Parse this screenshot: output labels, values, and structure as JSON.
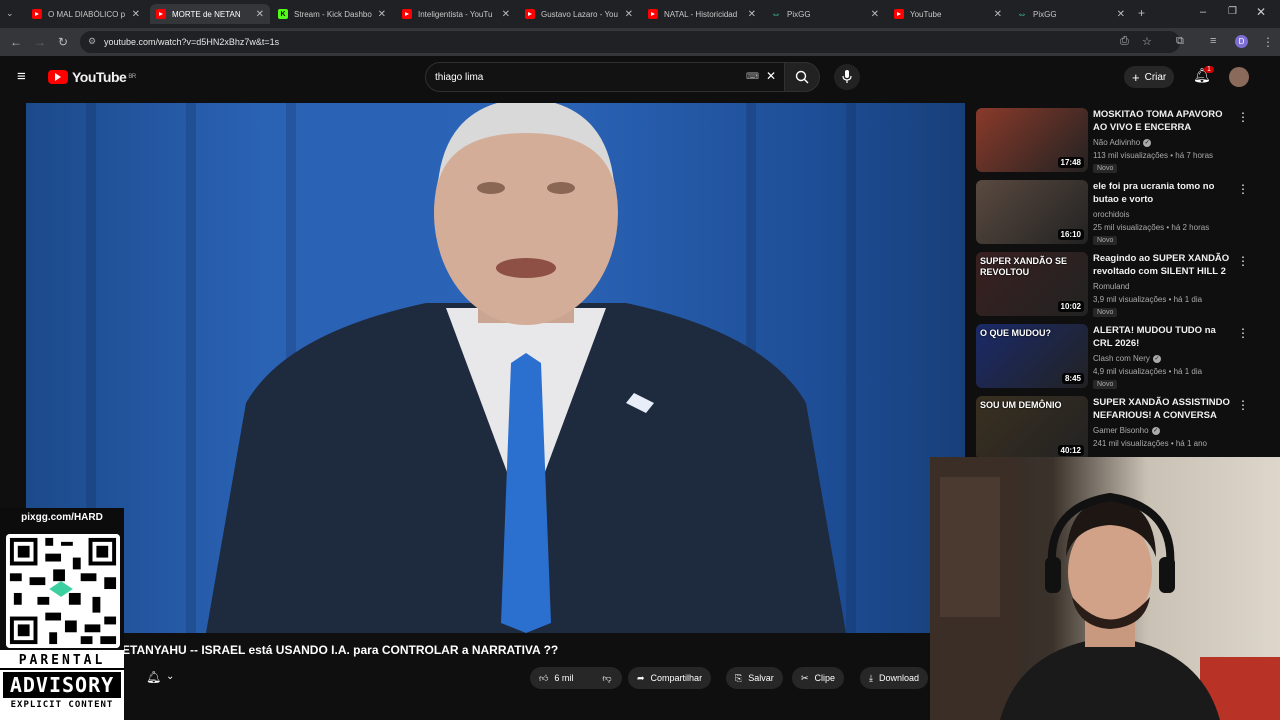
{
  "browser": {
    "tabs": [
      {
        "title": "O MAL DIABÓLICO p",
        "icon": "youtube-icon",
        "active": false
      },
      {
        "title": "MORTE de NETAN",
        "icon": "youtube-icon",
        "active": true
      },
      {
        "title": "Stream - Kick Dashbo",
        "icon": "kick-icon",
        "active": false
      },
      {
        "title": "Inteligentista - YouTu",
        "icon": "youtube-icon",
        "active": false
      },
      {
        "title": "Gustavo Lazaro - You",
        "icon": "youtube-icon",
        "active": false
      },
      {
        "title": "NATAL - Historicidad",
        "icon": "youtube-icon",
        "active": false
      },
      {
        "title": "PixGG",
        "icon": "pixgg-icon",
        "active": false
      },
      {
        "title": "YouTube",
        "icon": "youtube-icon",
        "active": false
      },
      {
        "title": "PixGG",
        "icon": "pixgg-icon",
        "active": false
      }
    ],
    "url": "youtube.com/watch?v=d5HN2xBhz7w&t=1s"
  },
  "youtube": {
    "logo_text": "YouTube",
    "region": "BR",
    "search_value": "thiago lima",
    "create_label": "Criar",
    "notification_count": "1"
  },
  "video": {
    "title": "ETANYAHU -- ISRAEL está USANDO I.A. para CONTROLAR a NARRATIVA ??",
    "likes": "6 mil",
    "share_label": "Compartilhar",
    "save_label": "Salvar",
    "clip_label": "Clipe",
    "download_label": "Download"
  },
  "overlay": {
    "pix_url": "pixgg.com/HARD",
    "advisory_line1": "PARENTAL",
    "advisory_line2": "ADVISORY",
    "advisory_line3": "EXPLICIT CONTENT"
  },
  "recommendations": [
    {
      "title": "MOSKITAO TOMA APAVORO AO VIVO E ENCERRA ENTREVISTA",
      "channel": "Não Adivinho",
      "verified": true,
      "meta": "113 mil visualizações • há 7 horas",
      "badge": "Novo",
      "duration": "17:48",
      "thumb_text": "",
      "thumb_color": "#8a3a2a"
    },
    {
      "title": "ele foi pra ucrania tomo no butao e vorto",
      "channel": "orochidois",
      "verified": false,
      "meta": "25 mil visualizações • há 2 horas",
      "badge": "Novo",
      "duration": "16:10",
      "thumb_text": "",
      "thumb_color": "#5a4a40"
    },
    {
      "title": "Reagindo ao SUPER XANDÃO revoltado com SILENT HILL 2 ...",
      "channel": "Romuland",
      "verified": false,
      "meta": "3,9 mil visualizações • há 1 dia",
      "badge": "Novo",
      "duration": "10:02",
      "thumb_text": "SUPER XANDÃO SE REVOLTOU",
      "thumb_color": "#3a2020"
    },
    {
      "title": "ALERTA! MUDOU TUDO na CRL 2026!",
      "channel": "Clash com Nery",
      "verified": true,
      "meta": "4,9 mil visualizações • há 1 dia",
      "badge": "Novo",
      "duration": "8:45",
      "thumb_text": "O QUE MUDOU?",
      "thumb_color": "#1a2a6a"
    },
    {
      "title": "SUPER XANDÃO ASSISTINDO NEFARIOUS! A CONVERSA CO...",
      "channel": "Gamer Bisonho",
      "verified": true,
      "meta": "241 mil visualizações • há 1 ano",
      "badge": "",
      "duration": "40:12",
      "thumb_text": "SOU UM DEMÔNIO",
      "thumb_color": "#3a3020"
    }
  ]
}
